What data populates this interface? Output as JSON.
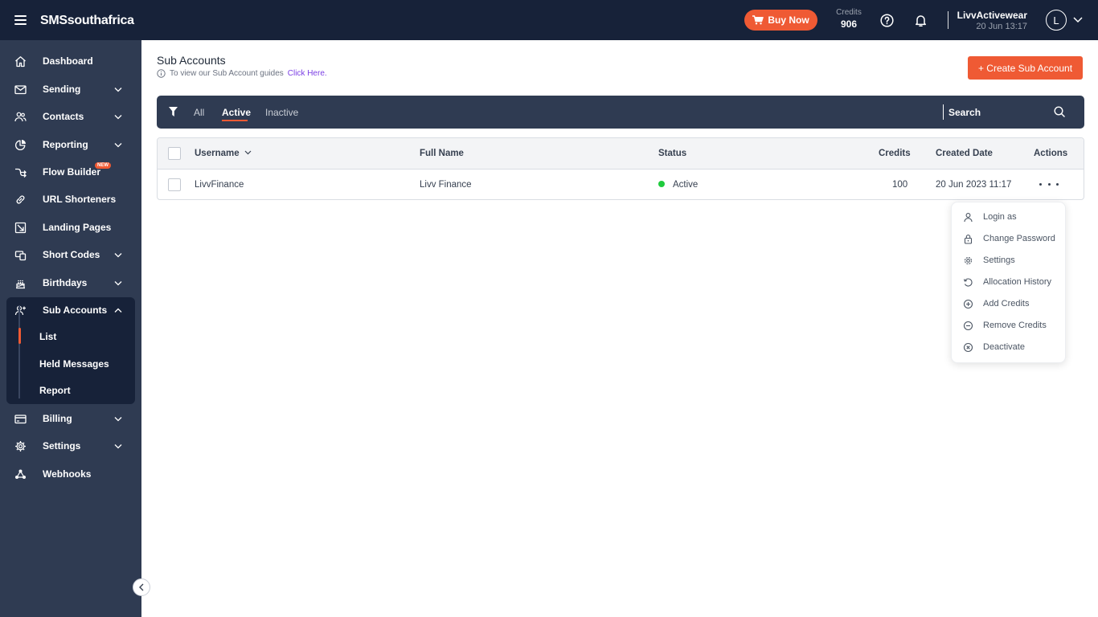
{
  "topbar": {
    "brand": "SMSsouthafrica",
    "buy_now": "Buy Now",
    "credits_label": "Credits",
    "credits_value": "906",
    "user_name": "LivvActivewear",
    "user_time": "20 Jun 13:17",
    "avatar_initial": "L"
  },
  "sidebar": {
    "items": [
      {
        "label": "Dashboard",
        "icon": "home-icon"
      },
      {
        "label": "Sending",
        "icon": "mail-icon"
      },
      {
        "label": "Contacts",
        "icon": "contacts-icon"
      },
      {
        "label": "Reporting",
        "icon": "pie-chart-icon"
      },
      {
        "label": "Flow Builder",
        "icon": "flow-icon",
        "badge": "NEW"
      },
      {
        "label": "URL Shorteners",
        "icon": "link-icon"
      },
      {
        "label": "Landing Pages",
        "icon": "landing-page-icon"
      },
      {
        "label": "Short Codes",
        "icon": "short-codes-icon"
      },
      {
        "label": "Birthdays",
        "icon": "cake-icon"
      },
      {
        "label": "Sub Accounts",
        "icon": "user-plus-icon"
      },
      {
        "label": "Billing",
        "icon": "card-icon"
      },
      {
        "label": "Settings",
        "icon": "gear-icon"
      },
      {
        "label": "Webhooks",
        "icon": "webhooks-icon"
      }
    ],
    "sub_items": [
      "List",
      "Held Messages",
      "Report"
    ]
  },
  "main": {
    "title": "Sub Accounts",
    "subtitle_text": "To view our Sub Account guides",
    "subtitle_link": "Click Here.",
    "create_button": "+ Create Sub Account",
    "filters": {
      "tabs": [
        "All",
        "Active",
        "Inactive"
      ],
      "active_tab": "Active",
      "search_placeholder": "Search"
    },
    "table": {
      "headers": {
        "username": "Username",
        "full_name": "Full Name",
        "status": "Status",
        "credits": "Credits",
        "created_date": "Created Date",
        "actions": "Actions"
      },
      "rows": [
        {
          "username": "LivvFinance",
          "full_name": "Livv Finance",
          "status": "Active",
          "credits": "100",
          "created_date": "20 Jun 2023 11:17"
        }
      ]
    },
    "actions_menu": [
      {
        "label": "Login as",
        "icon": "user-icon"
      },
      {
        "label": "Change Password",
        "icon": "lock-icon"
      },
      {
        "label": "Settings",
        "icon": "gear-icon"
      },
      {
        "label": "Allocation History",
        "icon": "history-icon"
      },
      {
        "label": "Add Credits",
        "icon": "plus-circle-icon"
      },
      {
        "label": "Remove Credits",
        "icon": "minus-circle-icon"
      },
      {
        "label": "Deactivate",
        "icon": "x-circle-icon"
      }
    ]
  },
  "colors": {
    "topbar": "#172239",
    "sidebar": "#2f3b52",
    "accent": "#ef5a34",
    "status_active": "#1fcb3d",
    "link": "#7b3fe4"
  }
}
